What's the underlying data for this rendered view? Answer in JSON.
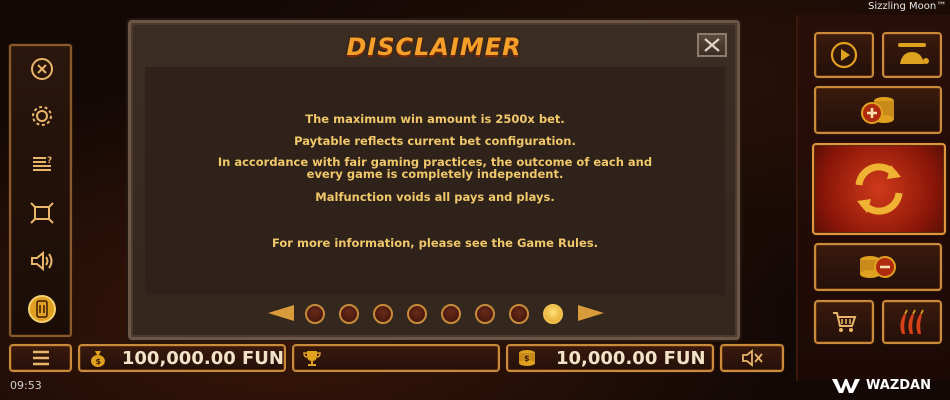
{
  "game": {
    "name": "Sizzling Moon™"
  },
  "dialog": {
    "title": "DISCLAIMER",
    "lines": [
      "The maximum win amount is 2500x bet.",
      "Paytable reflects current bet configuration.",
      "In accordance with fair gaming practices, the outcome of each and",
      "every game is completely independent.",
      "Malfunction voids all pays and plays.",
      "For more information, please see the Game Rules."
    ],
    "pager": {
      "page_count": 8,
      "current_page": 8
    }
  },
  "left_menu": {
    "items": [
      "close-icon",
      "settings-icon",
      "paytable-icon",
      "fullscreen-icon",
      "sound-icon",
      "info-icon"
    ]
  },
  "bottom_bar": {
    "balance": "100,000.00 FUN",
    "win": "",
    "bet": "10,000.00 FUN"
  },
  "status_bar": {
    "time": "09:53"
  },
  "brand": {
    "name": "WAZDAN"
  },
  "colors": {
    "accent": "#f4a02a",
    "text": "#f0c76a",
    "frame": "#c98a3a",
    "spin": "#c0301a"
  }
}
